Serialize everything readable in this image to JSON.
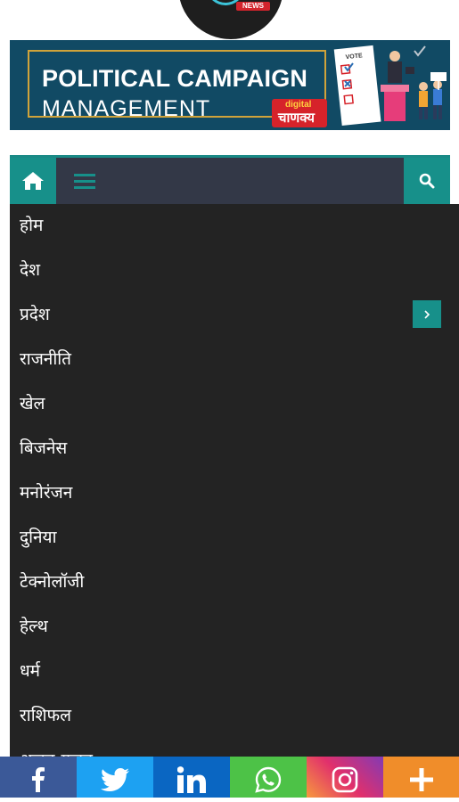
{
  "site": {
    "logo_badge": "NEWS"
  },
  "banner": {
    "title_line1": "POLITICAL CAMPAIGN",
    "title_line2": "MANAGEMENT",
    "brand_top": "digital",
    "brand_main": "चाणक्य",
    "vote_label": "VOTE"
  },
  "navbar": {
    "home_icon": "home-icon",
    "menu_icon": "hamburger-icon",
    "search_icon": "search-icon",
    "accent": "#17908a",
    "background": "#333847"
  },
  "menu": {
    "items": [
      {
        "label": "होम"
      },
      {
        "label": "देश"
      },
      {
        "label": "प्रदेश",
        "has_submenu": true
      },
      {
        "label": "राजनीति"
      },
      {
        "label": "खेल"
      },
      {
        "label": "बिजनेस"
      },
      {
        "label": "मनोरंजन"
      },
      {
        "label": "दुनिया"
      },
      {
        "label": "टेक्नोलॉजी"
      },
      {
        "label": "हेल्थ"
      },
      {
        "label": "धर्म"
      },
      {
        "label": "राशिफल"
      },
      {
        "label": "अजब-गजब"
      }
    ],
    "background": "#232323"
  },
  "share_bar": {
    "buttons": [
      {
        "name": "facebook",
        "color": "#3b5998"
      },
      {
        "name": "twitter",
        "color": "#1da1f2"
      },
      {
        "name": "linkedin",
        "color": "#0a66c2"
      },
      {
        "name": "whatsapp",
        "color": "#4dc247"
      },
      {
        "name": "instagram",
        "color": "#e1306c"
      },
      {
        "name": "more",
        "color": "#f08d2a"
      }
    ]
  }
}
